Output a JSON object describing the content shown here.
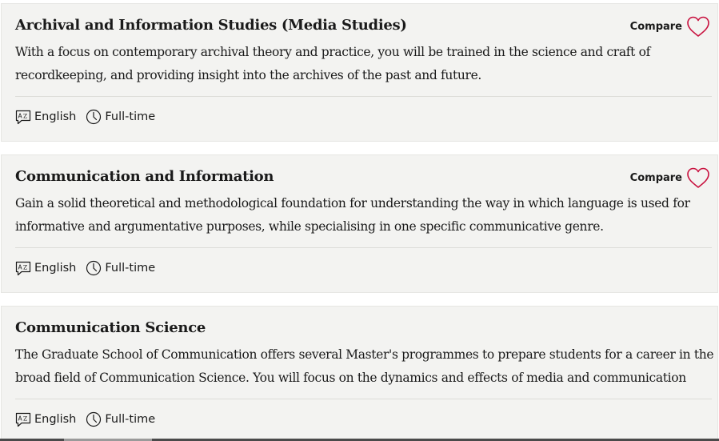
{
  "programmes": [
    {
      "title": "Archival and Information Studies (Media Studies)",
      "description_lines": [
        "With a focus on contemporary archival theory and practice, you will be trained in the science and craft of",
        "recordkeeping, and providing insight into the archives of the past and future."
      ],
      "compare_label": "Compare",
      "language": "English",
      "mode": "Full-time"
    },
    {
      "title": "Communication and Information",
      "description_lines": [
        "Gain a solid theoretical and methodological foundation for understanding the way in which language is used for",
        "informative and argumentative purposes, while specialising in one specific communicative genre."
      ],
      "compare_label": "Compare",
      "language": "English",
      "mode": "Full-time"
    },
    {
      "title": "Communication Science",
      "description_lines": [
        "The Graduate School of Communication offers several Master's programmes to prepare students for a career in the",
        "broad field of Communication Science. You will focus on the dynamics and effects of media and communication"
      ],
      "language": "English",
      "mode": "Full-time"
    }
  ],
  "icons": {
    "compare": "heart-icon",
    "language": "translate-icon",
    "mode": "clock-icon"
  },
  "colors": {
    "heart": "#c8103e",
    "card_bg": "#f3f3f1",
    "text": "#1a1a1a"
  }
}
